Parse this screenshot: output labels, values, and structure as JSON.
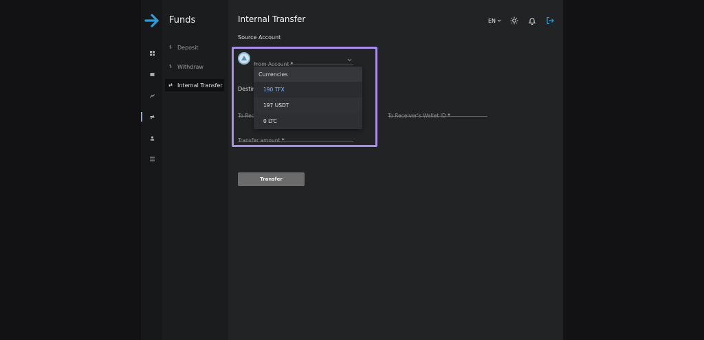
{
  "nav": {
    "title": "Funds",
    "items": [
      {
        "label": "Deposit",
        "icon": "deposit-icon"
      },
      {
        "label": "Withdraw",
        "icon": "withdraw-icon"
      },
      {
        "label": "Internal Transfer",
        "icon": "transfer-icon",
        "active": true
      }
    ]
  },
  "page": {
    "title": "Internal Transfer",
    "source_account_label": "Source Account",
    "destination_label_visible": "Destin"
  },
  "topbar": {
    "language": "EN"
  },
  "form": {
    "from_account_placeholder": "From Account",
    "receiver_placeholder_visible": "To Rec",
    "wallet_id_placeholder": "To Receiver's Wallet ID",
    "amount_placeholder": "Transfer amount",
    "required_mark": "*",
    "submit_label": "Transfer"
  },
  "dropdown": {
    "header": "Currencies",
    "options": [
      {
        "label": "190 TFX",
        "selected": true
      },
      {
        "label": "197 USDT",
        "selected": false
      },
      {
        "label": "0 LTC",
        "selected": false
      }
    ]
  },
  "colors": {
    "accent": "#2f9bd9",
    "highlight": "#a78ee8",
    "selected_option": "#7fb7ff"
  }
}
